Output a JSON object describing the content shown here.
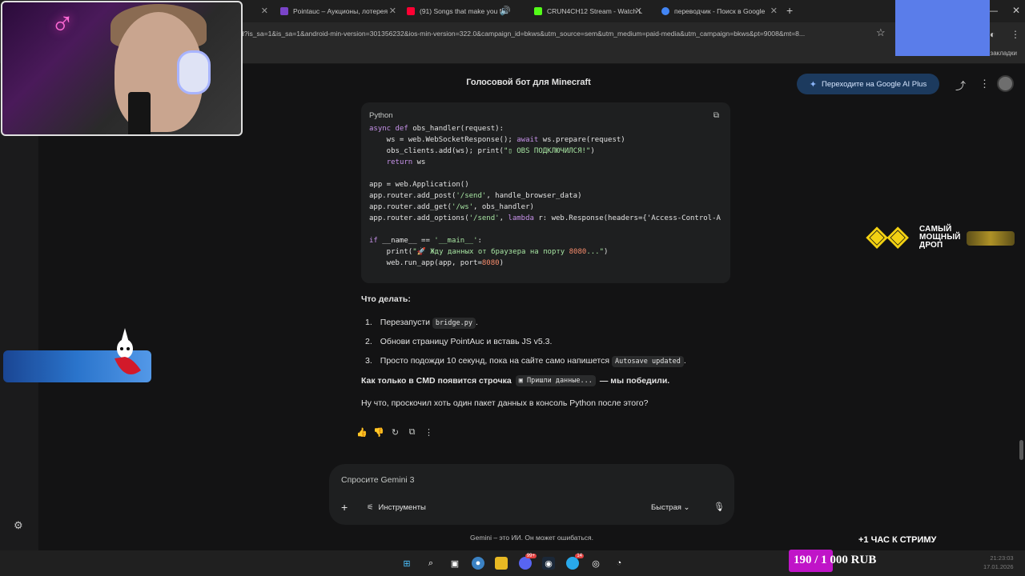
{
  "browser": {
    "tabs": [
      {
        "label": "",
        "color": "#3a3a3a"
      },
      {
        "label": "Pointauc – Аукционы, лотерея",
        "color": "#7a44c8"
      },
      {
        "label": "(91) Songs that make you fe",
        "color": "#ff0033"
      },
      {
        "label": "CRUN4CH12 Stream - Watch Li",
        "color": "#53fc18"
      },
      {
        "label": "переводчик - Поиск в Google",
        "color": "#4285f4"
      }
    ],
    "new_tab": "+",
    "url": "d?is_sa=1&is_sa=1&android-min-version=301356232&ios-min-version=322.0&campaign_id=bkws&utm_source=sem&utm_medium=paid-media&utm_campaign=bkws&pt=9008&mt=8...",
    "bookmarks_label": "се закладки"
  },
  "gemini": {
    "title": "Голосовой бот для Minecraft",
    "upgrade_label": "Переходите на Google AI Plus",
    "code_lang": "Python",
    "code_lines": [
      "async def obs_handler(request):",
      "    ws = web.WebSocketResponse(); await ws.prepare(request)",
      "    obs_clients.add(ws); print(\"▯ OBS ПОДКЛЮЧИЛСЯ!\")",
      "    return ws",
      "",
      "app = web.Application()",
      "app.router.add_post('/send', handle_browser_data)",
      "app.router.add_get('/ws', obs_handler)",
      "app.router.add_options('/send', lambda r: web.Response(headers={'Access-Control-A",
      "",
      "if __name__ == '__main__':",
      "    print(\"🚀 Жду данных от браузера на порту 8080...\")",
      "    web.run_app(app, port=8080)"
    ],
    "what_to_do": "Что делать:",
    "steps": [
      {
        "num": "1.",
        "text": "Перезапусти",
        "code": "bridge.py",
        "after": "."
      },
      {
        "num": "2.",
        "text": "Обнови страницу PointAuc и вставь JS v5.3.",
        "code": "",
        "after": ""
      },
      {
        "num": "3.",
        "text": "Просто подожди 10 секунд, пока на сайте само напишется",
        "code": "Autosave updated",
        "after": "."
      }
    ],
    "bold_line_pre": "Как только в CMD появится строчка",
    "bold_line_code": "▣ Пришли данные...",
    "bold_line_post": "— мы победили.",
    "question": "Ну что, проскочил хоть один пакет данных в консоль Python после этого?",
    "prompt_placeholder": "Спросите Gemini 3",
    "tools_label": "Инструменты",
    "mode_label": "Быстрая",
    "disclaimer": "Gemini – это ИИ. Он может ошибаться."
  },
  "overlays": {
    "promo_line1": "САМЫЙ",
    "promo_line2": "МОЩНЫЙ",
    "promo_line3": "ДРОП",
    "stream_note": "+1 ЧАС К СТРИМУ",
    "donation_text": "190 / 1 000 RUB",
    "donation_progress": 0.19,
    "colors": {
      "donation": "#c014c8",
      "promo": "#f3d112",
      "upgrade_bg": "#1c3a5e"
    }
  },
  "taskbar": {
    "icons": [
      "windows-start",
      "search",
      "task-view",
      "chrome",
      "file-explorer",
      "discord",
      "steam",
      "telegram",
      "obs",
      "speedometer"
    ],
    "discord_badge": "99+",
    "telegram_badge": "14",
    "time": "21:23:03",
    "date": "17.01.2026"
  }
}
